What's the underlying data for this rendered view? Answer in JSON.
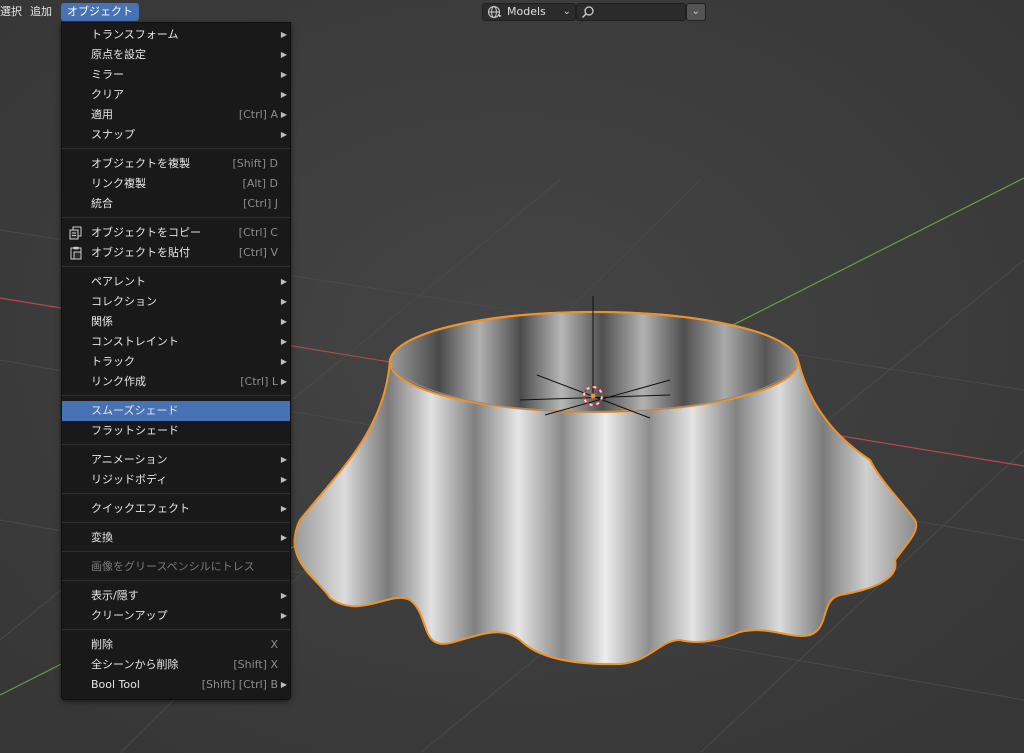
{
  "header": {
    "menus": [
      {
        "label": "選択",
        "active": false
      },
      {
        "label": "追加",
        "active": false
      },
      {
        "label": "オブジェクト",
        "active": true
      }
    ],
    "view_layer_select": {
      "value": "Models"
    },
    "search": {
      "value": ""
    }
  },
  "object_menu": {
    "items": [
      {
        "label": "トランスフォーム",
        "shortcut": "",
        "submenu": true
      },
      {
        "label": "原点を設定",
        "shortcut": "",
        "submenu": true
      },
      {
        "label": "ミラー",
        "shortcut": "",
        "submenu": true
      },
      {
        "label": "クリア",
        "shortcut": "",
        "submenu": true
      },
      {
        "label": "適用",
        "shortcut": "[Ctrl] A",
        "submenu": true
      },
      {
        "label": "スナップ",
        "shortcut": "",
        "submenu": true
      },
      {
        "label": "オブジェクトを複製",
        "shortcut": "[Shift] D",
        "submenu": false
      },
      {
        "label": "リンク複製",
        "shortcut": "[Alt] D",
        "submenu": false
      },
      {
        "label": "統合",
        "shortcut": "[Ctrl] J",
        "submenu": false
      },
      {
        "label": "オブジェクトをコピー",
        "shortcut": "[Ctrl] C",
        "submenu": false,
        "icon": "copy-icon"
      },
      {
        "label": "オブジェクトを貼付",
        "shortcut": "[Ctrl] V",
        "submenu": false,
        "icon": "paste-icon"
      },
      {
        "label": "ペアレント",
        "shortcut": "",
        "submenu": true
      },
      {
        "label": "コレクション",
        "shortcut": "",
        "submenu": true
      },
      {
        "label": "関係",
        "shortcut": "",
        "submenu": true
      },
      {
        "label": "コンストレイント",
        "shortcut": "",
        "submenu": true
      },
      {
        "label": "トラック",
        "shortcut": "",
        "submenu": true
      },
      {
        "label": "リンク作成",
        "shortcut": "[Ctrl] L",
        "submenu": true
      },
      {
        "label": "スムーズシェード",
        "shortcut": "",
        "submenu": false,
        "highlighted": true
      },
      {
        "label": "フラットシェード",
        "shortcut": "",
        "submenu": false
      },
      {
        "label": "アニメーション",
        "shortcut": "",
        "submenu": true
      },
      {
        "label": "リジッドボディ",
        "shortcut": "",
        "submenu": true
      },
      {
        "label": "クイックエフェクト",
        "shortcut": "",
        "submenu": true
      },
      {
        "label": "変換",
        "shortcut": "",
        "submenu": true
      },
      {
        "label": "画像をグリースペンシルにトレス",
        "shortcut": "",
        "submenu": false,
        "disabled": true
      },
      {
        "label": "表示/隠す",
        "shortcut": "",
        "submenu": true
      },
      {
        "label": "クリーンアップ",
        "shortcut": "",
        "submenu": true
      },
      {
        "label": "削除",
        "shortcut": "X",
        "submenu": false
      },
      {
        "label": "全シーンから削除",
        "shortcut": "[Shift] X",
        "submenu": false
      },
      {
        "label": "Bool Tool",
        "shortcut": "[Shift] [Ctrl] B",
        "submenu": true
      }
    ]
  },
  "colors": {
    "accent": "#4772b3",
    "selection_outline": "#f0922a",
    "x_axis": "#b5484f",
    "y_axis": "#6f9a3c"
  }
}
